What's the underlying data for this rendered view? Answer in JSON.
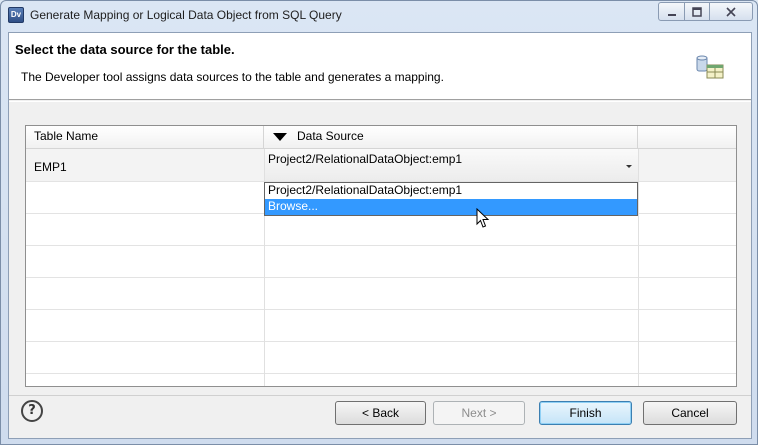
{
  "window": {
    "title": "Generate Mapping or Logical Data Object from SQL Query",
    "app_icon_label": "Dv",
    "minimize_icon": "minimize-icon",
    "maximize_icon": "maximize-icon",
    "close_icon": "close-icon"
  },
  "header": {
    "title": "Select the data source for the table.",
    "description": "The Developer tool assigns data sources to the table and generates a mapping.",
    "icon": "data-source-wizard-icon"
  },
  "table": {
    "columns": [
      "Table Name",
      "Data Source",
      ""
    ],
    "rows": [
      {
        "table_name": "EMP1",
        "data_source": "Project2/RelationalDataObject:emp1"
      }
    ],
    "dropdown_options": [
      "Project2/RelationalDataObject:emp1",
      "Browse..."
    ],
    "highlighted_option": "Browse..."
  },
  "footer": {
    "help_label": "?",
    "back_label": "< Back",
    "next_label": "Next >",
    "finish_label": "Finish",
    "cancel_label": "Cancel"
  },
  "colors": {
    "selection": "#3399ff",
    "dialog_bg": "#f0f0f0",
    "window_frame": "#dbe6f4"
  }
}
